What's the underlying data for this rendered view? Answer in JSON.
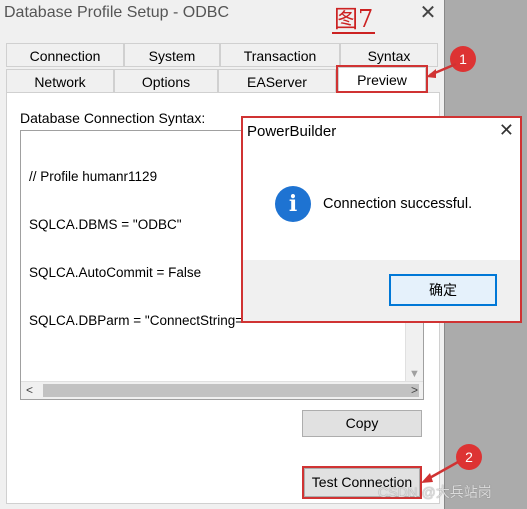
{
  "window": {
    "title": "Database Profile Setup - ODBC",
    "figure_label": "图7"
  },
  "tabs_back_row": [
    "Connection",
    "System",
    "Transaction",
    "Syntax"
  ],
  "tabs_front_row": [
    "Network",
    "Options",
    "EAServer",
    "Preview"
  ],
  "preview": {
    "label": "Database Connection Syntax:",
    "lines": [
      "// Profile humanr1129",
      "SQLCA.DBMS = \"ODBC\"",
      "SQLCA.AutoCommit = False",
      "SQLCA.DBParm = \"ConnectString='"
    ]
  },
  "buttons": {
    "copy_label": "Copy",
    "test_connection_label": "Test Connection"
  },
  "message_box": {
    "title": "PowerBuilder",
    "message": "Connection successful.",
    "ok_label": "确定"
  },
  "annotations": {
    "step1": "1",
    "step2": "2"
  },
  "watermark": "CSDN @大兵站岗",
  "colors": {
    "annotation_red": "#d03333",
    "info_blue": "#1e73d2"
  },
  "icons": [
    "close-icon",
    "info-icon",
    "scroll-left-icon",
    "scroll-right-icon",
    "scroll-up-icon",
    "scroll-down-icon"
  ]
}
